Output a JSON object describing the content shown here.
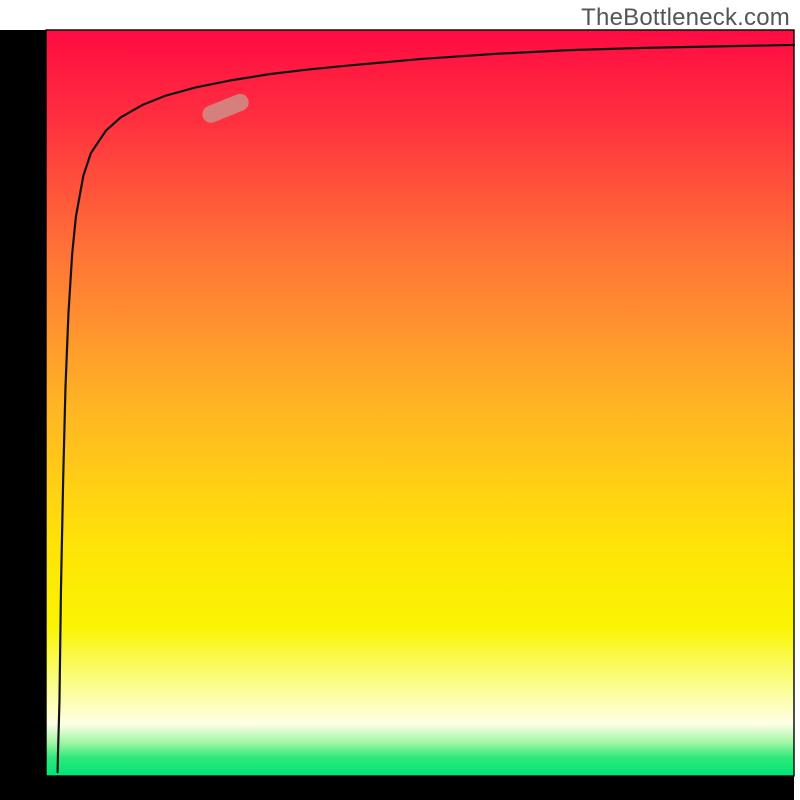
{
  "watermark": "TheBottleneck.com",
  "chart_data": {
    "type": "line",
    "title": "",
    "xlabel": "",
    "ylabel": "",
    "xlim": [
      0,
      100
    ],
    "ylim": [
      0,
      100
    ],
    "grid": false,
    "legend": false,
    "background_gradient": {
      "stops": [
        {
          "offset": 0.0,
          "color": "#ff0b42"
        },
        {
          "offset": 0.12,
          "color": "#ff2f3f"
        },
        {
          "offset": 0.3,
          "color": "#ff7437"
        },
        {
          "offset": 0.5,
          "color": "#ffb325"
        },
        {
          "offset": 0.68,
          "color": "#ffe109"
        },
        {
          "offset": 0.8,
          "color": "#faf502"
        },
        {
          "offset": 0.88,
          "color": "#fbfd90"
        },
        {
          "offset": 0.93,
          "color": "#fefee6"
        },
        {
          "offset": 0.955,
          "color": "#a2f6a6"
        },
        {
          "offset": 0.975,
          "color": "#2fe97a"
        },
        {
          "offset": 1.0,
          "color": "#00e577"
        }
      ]
    },
    "axis_frame_color": "#000000",
    "left_axis_width_frac": 0.058,
    "bottom_axis_height_frac": 0.03,
    "series": [
      {
        "name": "bottleneck-curve",
        "stroke": "#131313",
        "stroke_width": 2.2,
        "x": [
          1.6,
          1.8,
          2.0,
          2.3,
          2.6,
          3.0,
          3.5,
          4.0,
          5.0,
          6.0,
          8.0,
          10.0,
          13.0,
          16.0,
          20.0,
          25.0,
          30.0,
          35.0,
          40.0,
          50.0,
          60.0,
          70.0,
          80.0,
          90.0,
          100.0
        ],
        "y": [
          3.0,
          10.0,
          25.0,
          40.0,
          52.0,
          62.0,
          70.0,
          75.0,
          80.5,
          83.5,
          86.5,
          88.3,
          90.0,
          91.2,
          92.3,
          93.3,
          94.1,
          94.7,
          95.2,
          96.1,
          96.8,
          97.3,
          97.6,
          97.8,
          98.0
        ]
      }
    ],
    "marker": {
      "name": "highlight-pill",
      "fill": "#cf8c85",
      "opacity": 0.88,
      "center_x": 24.0,
      "center_y": 89.5,
      "length": 6.5,
      "thickness": 2.3,
      "angle_deg": -22
    }
  }
}
